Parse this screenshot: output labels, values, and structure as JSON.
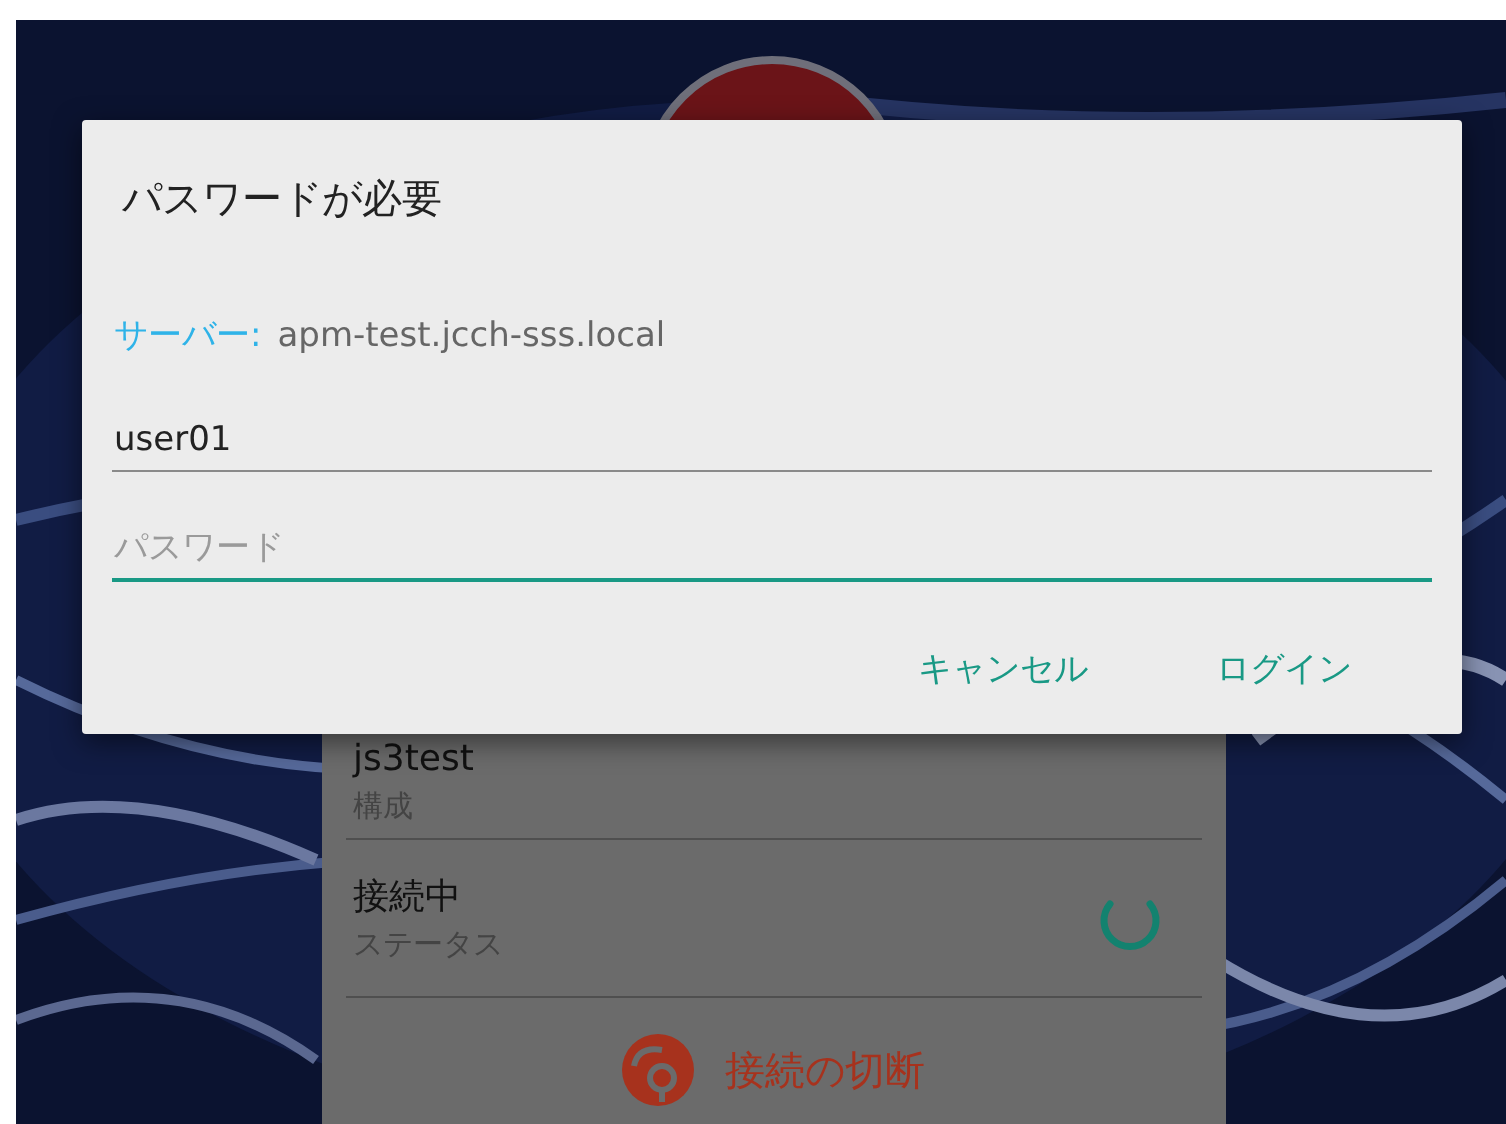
{
  "card": {
    "items": [
      {
        "kind": "plain",
        "title": "js3test",
        "subtitle": "構成"
      },
      {
        "kind": "spinner",
        "title": "接続中",
        "subtitle": "ステータス"
      }
    ],
    "action": {
      "label": "接続の切断"
    }
  },
  "dialog": {
    "title": "パスワードが必要",
    "server_label": "サーバー:",
    "server": "apm-test.jcch-sss.local",
    "fields": [
      {
        "kind": "username",
        "value": "user01",
        "focused": false
      },
      {
        "kind": "password",
        "placeholder": "パスワード",
        "focused": true
      }
    ],
    "buttons": [
      "キャンセル",
      "ログイン"
    ]
  }
}
